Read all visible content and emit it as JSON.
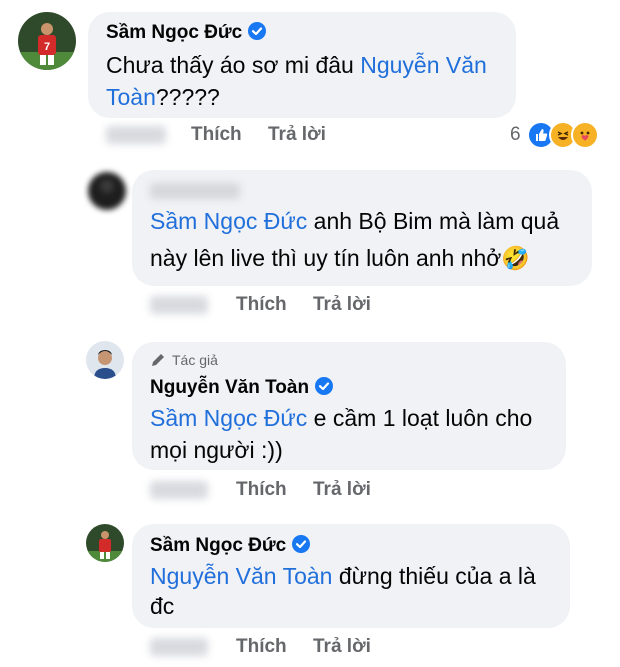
{
  "comments": [
    {
      "author": "Sầm Ngọc Đức",
      "mention": "Nguyễn Văn",
      "line1_rest": "",
      "line2_mention": "Toàn",
      "line2_rest": "?????",
      "prefix": "Chưa thấy áo sơ mi đâu",
      "like_label": "Thích",
      "reply_label": "Trả lời",
      "reaction_count": "6",
      "reactions": [
        "like-icon",
        "haha-icon",
        "care-icon"
      ]
    },
    {
      "author": "",
      "mention": "Sầm Ngọc Đức",
      "line1_rest": " anh Bộ Bim mà làm quả",
      "line2_rest": "này lên live thì uy tín luôn anh nhở🤣",
      "like_label": "Thích",
      "reply_label": "Trả lời"
    },
    {
      "author_badge": "Tác giả",
      "author": "Nguyễn Văn Toàn",
      "mention": "Sầm Ngọc Đức",
      "line1_rest": " e cầm 1 loạt luôn cho",
      "line2_rest": "mọi người :))",
      "like_label": "Thích",
      "reply_label": "Trả lời"
    },
    {
      "author": "Sầm Ngọc Đức",
      "mention": "Nguyễn Văn Toàn",
      "line1_rest": " đừng thiếu của a là",
      "line2_rest": "đc",
      "like_label": "Thích",
      "reply_label": "Trả lời"
    }
  ],
  "colors": {
    "mention": "#216fdb",
    "bubble": "#f0f2f5",
    "meta": "#65676b",
    "verified": "#1877f2"
  }
}
